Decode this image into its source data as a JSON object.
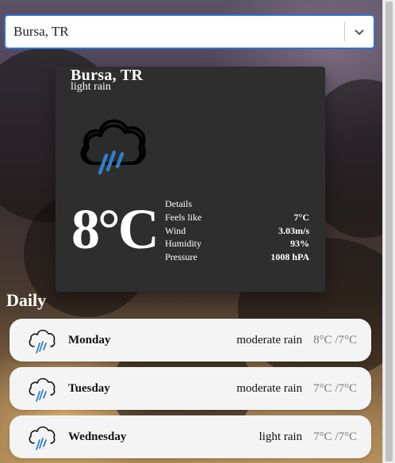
{
  "location_select": {
    "value": "Bursa, TR"
  },
  "current": {
    "city": "Bursa, TR",
    "description": "light rain",
    "icon": "rain-cloud-icon",
    "temperature": "8°C",
    "details_title": "Details",
    "details": [
      {
        "label": "Feels like",
        "value": "7°C"
      },
      {
        "label": "Wind",
        "value": "3.03m/s"
      },
      {
        "label": "Humidity",
        "value": "93%"
      },
      {
        "label": "Pressure",
        "value": "1008 hPA"
      }
    ]
  },
  "daily_label": "Daily",
  "forecast": [
    {
      "day": "Monday",
      "condition": "moderate rain",
      "range": "8°C /7°C",
      "icon": "rain-cloud-icon"
    },
    {
      "day": "Tuesday",
      "condition": "moderate rain",
      "range": "7°C /7°C",
      "icon": "rain-cloud-icon"
    },
    {
      "day": "Wednesday",
      "condition": "light rain",
      "range": "7°C /7°C",
      "icon": "rain-cloud-icon"
    }
  ],
  "colors": {
    "card_bg": "#2e2e2e",
    "select_border": "#2f6fd6",
    "rain_blue": "#2f7fc8",
    "row_bg": "#f4f4f4"
  }
}
